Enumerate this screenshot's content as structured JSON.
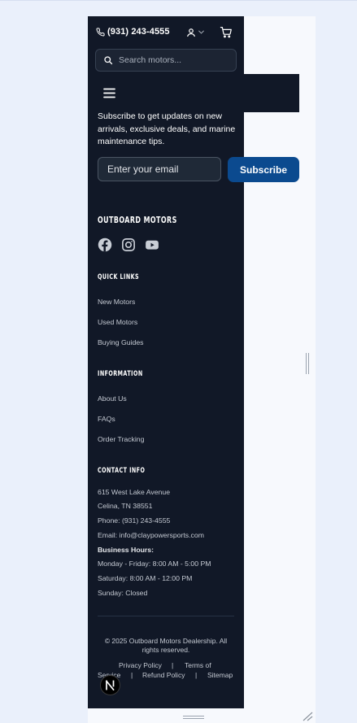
{
  "header": {
    "phone": "(931) 243-4555",
    "search_placeholder": "Search motors...",
    "icons": [
      "phone-icon",
      "user-icon",
      "chevron-down-icon",
      "cart-icon",
      "search-icon",
      "menu-icon"
    ]
  },
  "newsletter": {
    "description": "Subscribe to get updates on new arrivals, exclusive deals, and marine maintenance tips.",
    "email_placeholder": "Enter your email",
    "button_label": "Subscribe"
  },
  "footer": {
    "brand": "OUTBOARD MOTORS",
    "social": [
      "facebook-icon",
      "instagram-icon",
      "youtube-icon"
    ],
    "quick_links": {
      "title": "QUICK LINKS",
      "items": [
        "New Motors",
        "Used Motors",
        "Buying Guides"
      ]
    },
    "information": {
      "title": "INFORMATION",
      "items": [
        "About Us",
        "FAQs",
        "Order Tracking"
      ]
    },
    "contact": {
      "title": "CONTACT INFO",
      "address_line1": "615 West Lake Avenue",
      "address_line2": "Celina, TN 38551",
      "phone": "Phone: (931) 243-4555",
      "email": "Email: info@claypowersports.com",
      "hours_title": "Business Hours:",
      "hours": [
        "Monday - Friday: 8:00 AM - 5:00 PM",
        "Saturday: 8:00 AM - 12:00 PM",
        "Sunday: Closed"
      ]
    },
    "copyright": "© 2025 Outboard Motors Dealership. All rights reserved.",
    "legal": {
      "privacy": "Privacy Policy",
      "terms_line1": "Terms of",
      "terms_line2": "Service",
      "refund": "Refund Policy",
      "sitemap": "Sitemap",
      "separator": "|"
    }
  },
  "colors": {
    "footer_bg": "#111827",
    "page_bg": "#eaf0fb",
    "accent": "#0b4a8f",
    "text_muted": "#c4c9d2"
  }
}
